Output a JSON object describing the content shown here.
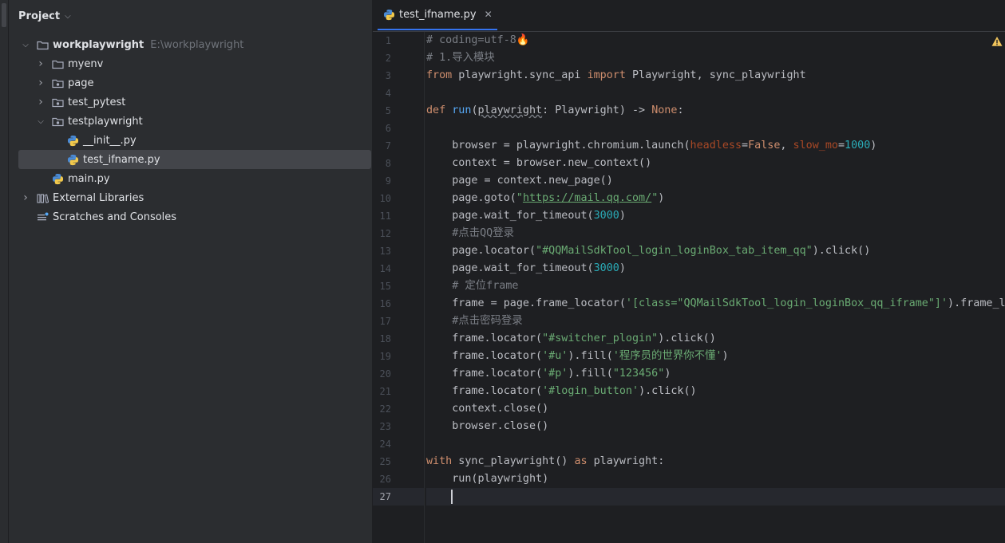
{
  "project_panel": {
    "title": "Project",
    "tree": [
      {
        "label": "workplaywright",
        "hint": "E:\\workplaywright",
        "level": 0,
        "expanded": true,
        "icon": "folder-icon"
      },
      {
        "label": "myenv",
        "level": 1,
        "expanded": false,
        "icon": "folder-icon"
      },
      {
        "label": "page",
        "level": 1,
        "expanded": false,
        "icon": "package-folder-icon"
      },
      {
        "label": "test_pytest",
        "level": 1,
        "expanded": false,
        "icon": "package-folder-icon"
      },
      {
        "label": "testplaywright",
        "level": 1,
        "expanded": true,
        "icon": "package-folder-icon"
      },
      {
        "label": "__init__.py",
        "level": 2,
        "icon": "python-file-icon"
      },
      {
        "label": "test_ifname.py",
        "level": 2,
        "icon": "python-file-icon",
        "selected": true
      },
      {
        "label": "main.py",
        "level": 1,
        "icon": "python-file-icon"
      },
      {
        "label": "External Libraries",
        "level": 0,
        "expanded": false,
        "icon": "library-icon"
      },
      {
        "label": "Scratches and Consoles",
        "level": 0,
        "icon": "scratches-icon"
      }
    ]
  },
  "editor": {
    "tab": {
      "label": "test_ifname.py",
      "icon": "python-file-icon"
    },
    "current_line": 27,
    "lines": [
      "# coding=utf-8🔥",
      "# 1.导入模块",
      "from playwright.sync_api import Playwright, sync_playwright",
      "",
      "def run(playwright: Playwright) -> None:",
      "",
      "    browser = playwright.chromium.launch(headless=False, slow_mo=1000)",
      "    context = browser.new_context()",
      "    page = context.new_page()",
      "    page.goto(\"https://mail.qq.com/\")",
      "    page.wait_for_timeout(3000)",
      "    #点击QQ登录",
      "    page.locator(\"#QQMailSdkTool_login_loginBox_tab_item_qq\").click()",
      "    page.wait_for_timeout(3000)",
      "    # 定位frame",
      "    frame = page.frame_locator('[class=\"QQMailSdkTool_login_loginBox_qq_iframe\"]').frame_lo",
      "    #点击密码登录",
      "    frame.locator(\"#switcher_plogin\").click()",
      "    frame.locator('#u').fill('程序员的世界你不懂')",
      "    frame.locator('#p').fill(\"123456\")",
      "    frame.locator('#login_button').click()",
      "    context.close()",
      "    browser.close()",
      "",
      "with sync_playwright() as playwright:",
      "    run(playwright)",
      ""
    ]
  },
  "colors": {
    "background": "#1e1f22",
    "panel": "#2b2d30",
    "keyword": "#cf8e6d",
    "function": "#56a8f5",
    "string": "#6aab73",
    "comment": "#7a7e85",
    "number": "#2aacb8",
    "parameter": "#aa4926"
  }
}
